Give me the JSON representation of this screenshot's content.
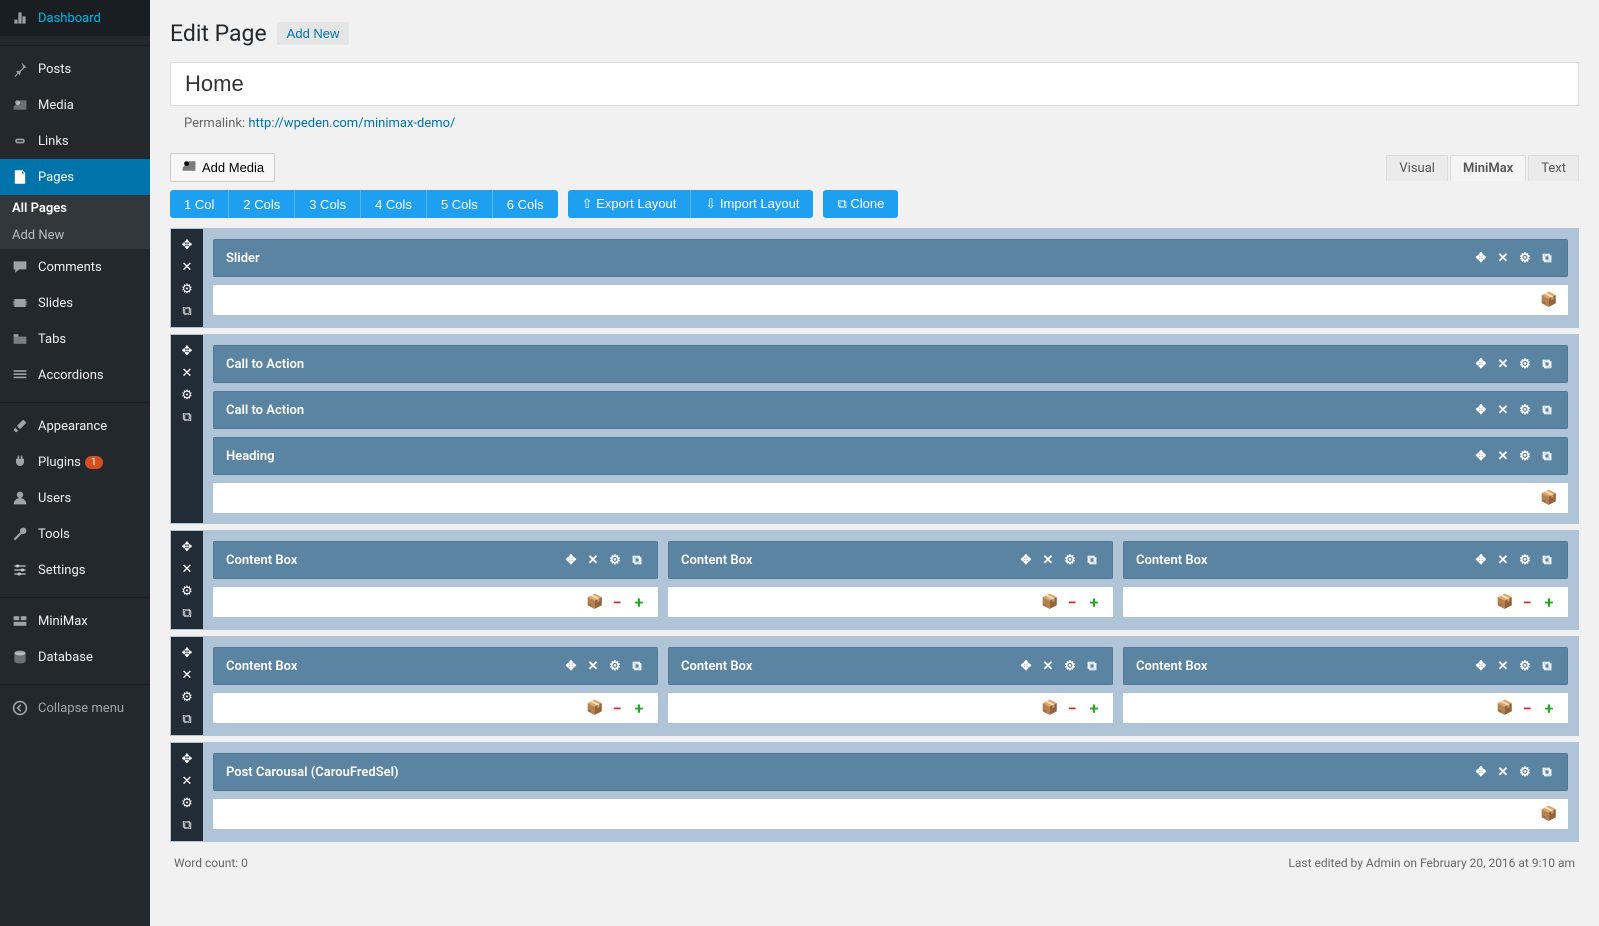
{
  "sidebar": {
    "items": [
      {
        "id": "dashboard",
        "label": "Dashboard"
      },
      {
        "id": "posts",
        "label": "Posts"
      },
      {
        "id": "media",
        "label": "Media"
      },
      {
        "id": "links",
        "label": "Links"
      },
      {
        "id": "pages",
        "label": "Pages",
        "active": true,
        "sub": [
          {
            "label": "All Pages",
            "current": true
          },
          {
            "label": "Add New"
          }
        ]
      },
      {
        "id": "comments",
        "label": "Comments"
      },
      {
        "id": "slides",
        "label": "Slides"
      },
      {
        "id": "tabs",
        "label": "Tabs"
      },
      {
        "id": "accordions",
        "label": "Accordions"
      },
      {
        "id": "appearance",
        "label": "Appearance"
      },
      {
        "id": "plugins",
        "label": "Plugins",
        "badge": "1"
      },
      {
        "id": "users",
        "label": "Users"
      },
      {
        "id": "tools",
        "label": "Tools"
      },
      {
        "id": "settings",
        "label": "Settings"
      },
      {
        "id": "minimax",
        "label": "MiniMax"
      },
      {
        "id": "database",
        "label": "Database"
      },
      {
        "id": "collapse",
        "label": "Collapse menu"
      }
    ]
  },
  "header": {
    "title": "Edit Page",
    "add_new": "Add New",
    "page_title_value": "Home",
    "permalink_label": "Permalink:",
    "permalink_url": "http://wpeden.com/minimax-demo/"
  },
  "toolbar": {
    "add_media": "Add Media",
    "tabs": {
      "visual": "Visual",
      "minimax": "MiniMax",
      "text": "Text"
    },
    "cols": [
      "1 Col",
      "2 Cols",
      "3 Cols",
      "4 Cols",
      "5 Cols",
      "6 Cols"
    ],
    "export": "Export Layout",
    "import": "Import Layout",
    "clone": "Clone"
  },
  "rows": [
    {
      "columns": [
        {
          "widgets": [
            {
              "title": "Slider"
            }
          ],
          "footer": "simple"
        }
      ]
    },
    {
      "columns": [
        {
          "widgets": [
            {
              "title": "Call to Action"
            },
            {
              "title": "Call to Action"
            },
            {
              "title": "Heading"
            }
          ],
          "footer": "simple"
        }
      ]
    },
    {
      "columns": [
        {
          "widgets": [
            {
              "title": "Content Box"
            }
          ],
          "footer": "full"
        },
        {
          "widgets": [
            {
              "title": "Content Box"
            }
          ],
          "footer": "full"
        },
        {
          "widgets": [
            {
              "title": "Content Box"
            }
          ],
          "footer": "full"
        }
      ]
    },
    {
      "columns": [
        {
          "widgets": [
            {
              "title": "Content Box"
            }
          ],
          "footer": "full"
        },
        {
          "widgets": [
            {
              "title": "Content Box"
            }
          ],
          "footer": "full"
        },
        {
          "widgets": [
            {
              "title": "Content Box"
            }
          ],
          "footer": "full"
        }
      ]
    },
    {
      "columns": [
        {
          "widgets": [
            {
              "title": "Post Carousal (CarouFredSel)"
            }
          ],
          "footer": "simple"
        }
      ]
    }
  ],
  "status": {
    "word_count_label": "Word count: 0",
    "last_edited": "Last edited by Admin on February 20, 2016 at 9:10 am"
  }
}
